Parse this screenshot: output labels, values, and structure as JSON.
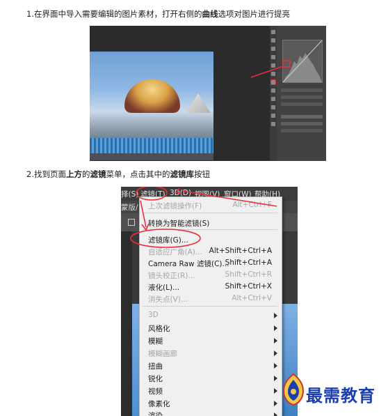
{
  "step1": {
    "text_a": "1.在界面中导入需要编辑的图片素材，打开右侧的",
    "bold": "曲线",
    "text_b": "选项对图片进行提亮"
  },
  "step2": {
    "text_a": "2.找到页面",
    "bold_a": "上方",
    "text_b": "的",
    "bold_b": "滤镜",
    "text_c": "菜单，点击其中的",
    "bold_c": "滤镜库",
    "text_d": "按钮"
  },
  "menubar": {
    "items": [
      "择(S)",
      "滤镜(T)",
      "3D(D)",
      "视图(V)",
      "窗口(W)",
      "帮助(H)"
    ],
    "sub_label": "蒙版/"
  },
  "filter_menu": {
    "items": [
      {
        "label": "上次滤镜操作(F)",
        "shortcut": "Alt+Ctrl+F",
        "disabled": true
      },
      {
        "label": "转换为智能滤镜(S)",
        "shortcut": "",
        "disabled": false
      },
      {
        "label": "滤镜库(G)...",
        "shortcut": "",
        "disabled": false
      },
      {
        "label": "自适应广角(A)...",
        "shortcut": "Alt+Shift+Ctrl+A",
        "disabled": true
      },
      {
        "label": "Camera Raw 滤镜(C)...",
        "shortcut": "Shift+Ctrl+A",
        "disabled": false
      },
      {
        "label": "镜头校正(R)...",
        "shortcut": "Shift+Ctrl+R",
        "disabled": true
      },
      {
        "label": "液化(L)...",
        "shortcut": "Shift+Ctrl+X",
        "disabled": false
      },
      {
        "label": "消失点(V)...",
        "shortcut": "Alt+Ctrl+V",
        "disabled": true
      },
      {
        "label": "3D",
        "shortcut": "",
        "disabled": true
      },
      {
        "label": "风格化",
        "shortcut": "",
        "disabled": false
      },
      {
        "label": "模糊",
        "shortcut": "",
        "disabled": false
      },
      {
        "label": "模糊画廊",
        "shortcut": "",
        "disabled": true
      },
      {
        "label": "扭曲",
        "shortcut": "",
        "disabled": false
      },
      {
        "label": "锐化",
        "shortcut": "",
        "disabled": false
      },
      {
        "label": "视频",
        "shortcut": "",
        "disabled": false
      },
      {
        "label": "像素化",
        "shortcut": "",
        "disabled": false
      },
      {
        "label": "渲染",
        "shortcut": "",
        "disabled": false
      }
    ]
  },
  "watermark": {
    "text": "最需教育",
    "color": "#1c3fae"
  },
  "colors": {
    "annotation_red": "#e8303a",
    "menu_bg": "#f0f0f0",
    "ps_dark": "#2b2b2b"
  }
}
